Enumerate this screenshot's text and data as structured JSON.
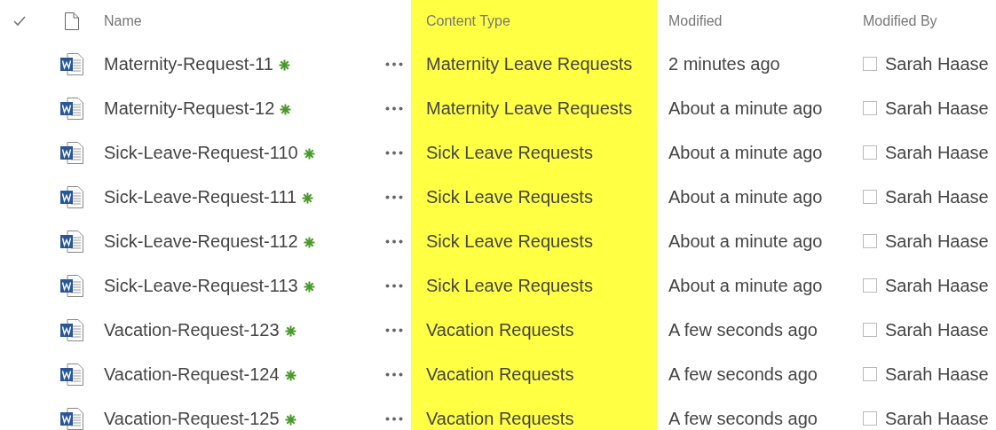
{
  "columns": [
    {
      "label": "Name",
      "highlighted": false
    },
    {
      "label": "Content Type",
      "highlighted": true
    },
    {
      "label": "Modified",
      "highlighted": false
    },
    {
      "label": "Modified By",
      "highlighted": false
    }
  ],
  "rows": [
    {
      "name": "Maternity-Request-11",
      "new": true,
      "content_type": "Maternity Leave Requests",
      "modified": "2 minutes ago",
      "modified_by": "Sarah Haase"
    },
    {
      "name": "Maternity-Request-12",
      "new": true,
      "content_type": "Maternity Leave Requests",
      "modified": "About a minute ago",
      "modified_by": "Sarah Haase"
    },
    {
      "name": "Sick-Leave-Request-110",
      "new": true,
      "content_type": "Sick Leave Requests",
      "modified": "About a minute ago",
      "modified_by": "Sarah Haase"
    },
    {
      "name": "Sick-Leave-Request-111",
      "new": true,
      "content_type": "Sick Leave Requests",
      "modified": "About a minute ago",
      "modified_by": "Sarah Haase"
    },
    {
      "name": "Sick-Leave-Request-112",
      "new": true,
      "content_type": "Sick Leave Requests",
      "modified": "About a minute ago",
      "modified_by": "Sarah Haase"
    },
    {
      "name": "Sick-Leave-Request-113",
      "new": true,
      "content_type": "Sick Leave Requests",
      "modified": "About a minute ago",
      "modified_by": "Sarah Haase"
    },
    {
      "name": "Vacation-Request-123",
      "new": true,
      "content_type": "Vacation Requests",
      "modified": "A few seconds ago",
      "modified_by": "Sarah Haase"
    },
    {
      "name": "Vacation-Request-124",
      "new": true,
      "content_type": "Vacation Requests",
      "modified": "A few seconds ago",
      "modified_by": "Sarah Haase"
    },
    {
      "name": "Vacation-Request-125",
      "new": true,
      "content_type": "Vacation Requests",
      "modified": "A few seconds ago",
      "modified_by": "Sarah Haase"
    }
  ]
}
